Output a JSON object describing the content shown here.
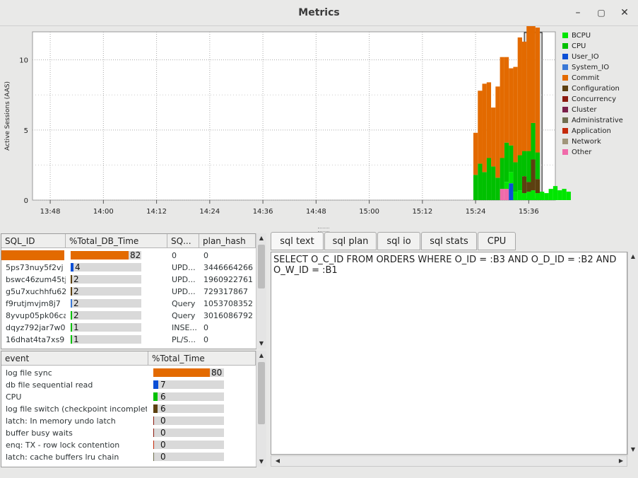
{
  "window": {
    "title": "Metrics"
  },
  "colors": {
    "BCPU": "#00e600",
    "CPU": "#00c000",
    "User_IO": "#0b4fd6",
    "System_IO": "#3a78d6",
    "Commit": "#e36a00",
    "Configuration": "#5c4010",
    "Concurrency": "#8b1a0e",
    "Cluster": "#7a1f4a",
    "Administrative": "#6f6f50",
    "Application": "#c4290a",
    "Network": "#a0957a",
    "Other": "#f06aaa"
  },
  "chart_data": {
    "type": "area",
    "ylabel": "Active Sessions (AAS)",
    "yticks": [
      "0",
      "5",
      "10"
    ],
    "ylim": [
      0,
      12
    ],
    "xticks": [
      "13:48",
      "14:00",
      "14:12",
      "14:24",
      "14:36",
      "14:48",
      "15:00",
      "15:12",
      "15:24",
      "15:36"
    ],
    "xlim": [
      "13:44",
      "15:42"
    ],
    "grid": true,
    "legend_position": "right",
    "legend": [
      "BCPU",
      "CPU",
      "User_IO",
      "System_IO",
      "Commit",
      "Configuration",
      "Concurrency",
      "Cluster",
      "Administrative",
      "Application",
      "Network",
      "Other"
    ],
    "selection_range": [
      "15:35",
      "15:39"
    ],
    "series": [
      {
        "name": "Other",
        "t": [
          15.3,
          15.31
        ],
        "values": [
          0.8,
          0.8
        ]
      },
      {
        "name": "User_IO",
        "t": [
          15.32
        ],
        "values": [
          1.2
        ]
      },
      {
        "name": "BCPU",
        "t": [
          15.31,
          15.32,
          15.33,
          15.34,
          15.35,
          15.36,
          15.37,
          15.38,
          15.39,
          15.4,
          15.41,
          15.42,
          15.43,
          15.44,
          15.45
        ],
        "values": [
          0.5,
          0.8,
          0.6,
          0.7,
          0.5,
          0.6,
          0.7,
          0.5,
          0.6,
          0.5,
          0.8,
          1.0,
          0.7,
          0.8,
          0.6
        ]
      },
      {
        "name": "Configuration",
        "t": [
          15.35,
          15.36,
          15.37,
          15.38
        ],
        "values": [
          1.2,
          0.7,
          2.2,
          1.0
        ]
      },
      {
        "name": "CPU",
        "t": [
          15.24,
          15.25,
          15.26,
          15.27,
          15.28,
          15.29,
          15.3,
          15.31,
          15.32,
          15.33,
          15.34,
          15.35,
          15.36,
          15.37,
          15.38
        ],
        "values": [
          1.8,
          2.6,
          2.0,
          3.0,
          2.4,
          1.6,
          2.2,
          2.8,
          1.9,
          2.1,
          2.5,
          1.8,
          2.2,
          2.6,
          1.9
        ]
      },
      {
        "name": "Commit",
        "t": [
          15.24,
          15.25,
          15.26,
          15.27,
          15.28,
          15.29,
          15.3,
          15.31,
          15.32,
          15.33,
          15.34,
          15.35,
          15.36,
          15.37,
          15.38
        ],
        "values": [
          3.0,
          5.2,
          6.3,
          5.4,
          4.2,
          6.5,
          7.2,
          6.1,
          5.5,
          6.8,
          8.4,
          7.8,
          9.6,
          8.6,
          8.9
        ]
      }
    ]
  },
  "sql_table": {
    "columns": [
      "SQL_ID",
      "%Total_DB_Time",
      "SQ...",
      "plan_hash"
    ],
    "rows": [
      {
        "sql_id": "",
        "pct": 82,
        "type": "0",
        "plan_hash": "0",
        "color": "#e36a00"
      },
      {
        "sql_id": "5ps73nuy5f2vj",
        "pct": 4,
        "type": "UPD...",
        "plan_hash": "3446664266",
        "color": "#0b4fd6"
      },
      {
        "sql_id": "bswc46zum45tj",
        "pct": 2,
        "type": "UPD...",
        "plan_hash": "1960922761",
        "color": "#5c4010"
      },
      {
        "sql_id": "g5u7xuchhfu62",
        "pct": 2,
        "type": "UPD...",
        "plan_hash": "729317867",
        "color": "#5c4010"
      },
      {
        "sql_id": "f9rutjmvjm8j7",
        "pct": 2,
        "type": "Query",
        "plan_hash": "1053708352",
        "color": "#3a78d6"
      },
      {
        "sql_id": "8yvup05pk06ca",
        "pct": 2,
        "type": "Query",
        "plan_hash": "3016086792",
        "color": "#00c000"
      },
      {
        "sql_id": "dqyz792jar7w0",
        "pct": 1,
        "type": "INSE...",
        "plan_hash": "0",
        "color": "#00c000"
      },
      {
        "sql_id": "16dhat4ta7xs9",
        "pct": 1,
        "type": "PL/S...",
        "plan_hash": "0",
        "color": "#00c000"
      }
    ]
  },
  "event_table": {
    "columns": [
      "event",
      "%Total_Time"
    ],
    "rows": [
      {
        "event": "log file sync",
        "pct": 80,
        "color": "#e36a00"
      },
      {
        "event": "db file sequential read",
        "pct": 7,
        "color": "#0b4fd6"
      },
      {
        "event": "CPU",
        "pct": 6,
        "color": "#00c000"
      },
      {
        "event": "log file switch (checkpoint incomplete)",
        "pct": 6,
        "color": "#5c4010"
      },
      {
        "event": "latch: In memory undo latch",
        "pct": 0,
        "color": "#8b1a0e"
      },
      {
        "event": "buffer busy waits",
        "pct": 0,
        "color": "#8b1a0e"
      },
      {
        "event": "enq: TX - row lock contention",
        "pct": 0,
        "color": "#c4290a"
      },
      {
        "event": "latch: cache buffers lru chain",
        "pct": 0,
        "color": "#6f6f50"
      }
    ]
  },
  "tabs": [
    "sql text",
    "sql plan",
    "sql io",
    "sql stats",
    "CPU"
  ],
  "active_tab": "sql text",
  "sql_text": "SELECT O_C_ID FROM ORDERS WHERE O_ID = :B3 AND O_D_ID = :B2 AND O_W_ID = :B1"
}
